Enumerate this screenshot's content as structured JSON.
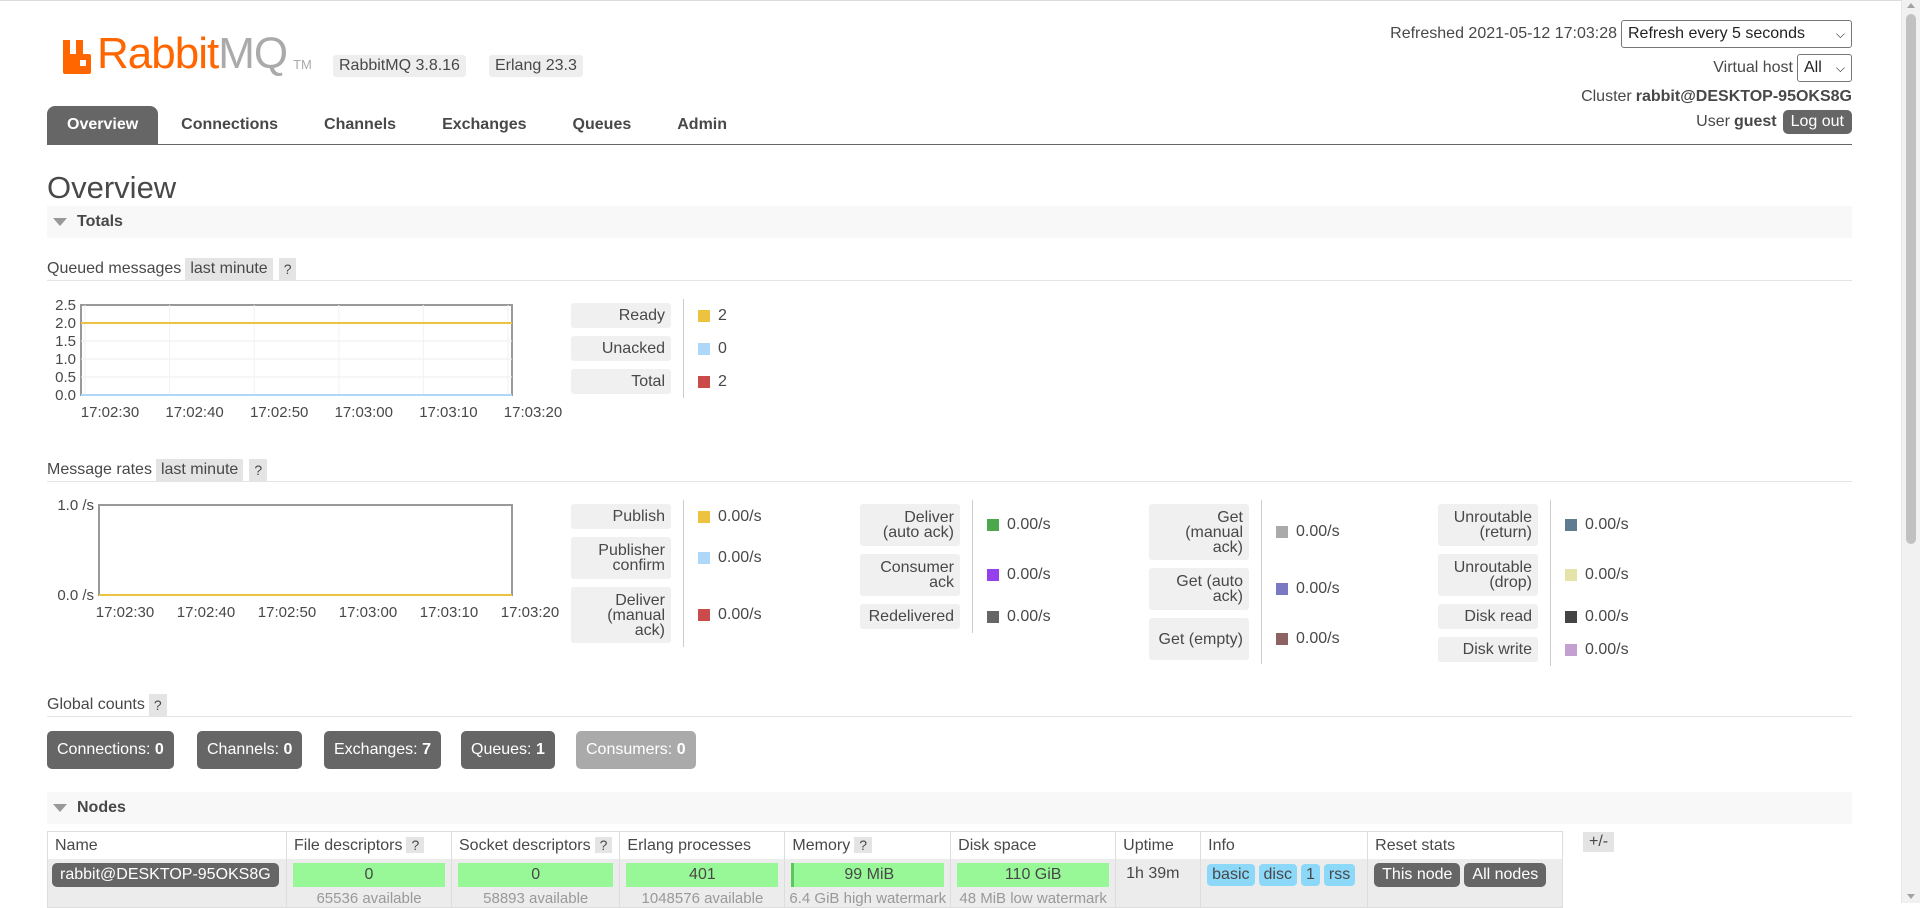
{
  "header": {
    "brand_primary": "Rabbit",
    "brand_secondary": "MQ",
    "brand_tm": "TM",
    "version_rabbitmq": "RabbitMQ 3.8.16",
    "version_erlang": "Erlang 23.3",
    "refreshed_label": "Refreshed 2021-05-12 17:03:28",
    "refresh_select": "Refresh every 5 seconds",
    "vhost_label": "Virtual host",
    "vhost_select": "All",
    "cluster_label": "Cluster",
    "cluster_value": "rabbit@DESKTOP-95OKS8G",
    "user_label": "User",
    "user_value": "guest",
    "logout_label": "Log out"
  },
  "tabs": [
    {
      "label": "Overview",
      "active": true
    },
    {
      "label": "Connections"
    },
    {
      "label": "Channels"
    },
    {
      "label": "Exchanges"
    },
    {
      "label": "Queues"
    },
    {
      "label": "Admin"
    }
  ],
  "page_title": "Overview",
  "totals": {
    "section_label": "Totals",
    "queued": {
      "label": "Queued messages",
      "range": "last minute",
      "help": "?",
      "legend": [
        {
          "label": "Ready",
          "value": "2",
          "color": "#edc240"
        },
        {
          "label": "Unacked",
          "value": "0",
          "color": "#afd8f8"
        },
        {
          "label": "Total",
          "value": "2",
          "color": "#cb4b4b"
        }
      ]
    },
    "rates": {
      "label": "Message rates",
      "range": "last minute",
      "help": "?",
      "columns": [
        [
          {
            "label": "Publish",
            "value": "0.00/s",
            "color": "#edc240"
          },
          {
            "label": "Publisher confirm",
            "value": "0.00/s",
            "color": "#afd8f8"
          },
          {
            "label": "Deliver (manual ack)",
            "value": "0.00/s",
            "color": "#cb4b4b"
          }
        ],
        [
          {
            "label": "Deliver (auto ack)",
            "value": "0.00/s",
            "color": "#4da74d"
          },
          {
            "label": "Consumer ack",
            "value": "0.00/s",
            "color": "#9440ed"
          },
          {
            "label": "Redelivered",
            "value": "0.00/s",
            "color": "#666666"
          }
        ],
        [
          {
            "label": "Get (manual ack)",
            "value": "0.00/s",
            "color": "#aaaaaa"
          },
          {
            "label": "Get (auto ack)",
            "value": "0.00/s",
            "color": "#7c79c3"
          },
          {
            "label": "Get (empty)",
            "value": "0.00/s",
            "color": "#8d6262"
          }
        ],
        [
          {
            "label": "Unroutable (return)",
            "value": "0.00/s",
            "color": "#5f7b8f"
          },
          {
            "label": "Unroutable (drop)",
            "value": "0.00/s",
            "color": "#e6e3a8"
          },
          {
            "label": "Disk read",
            "value": "0.00/s",
            "color": "#444444"
          },
          {
            "label": "Disk write",
            "value": "0.00/s",
            "color": "#c4a0d0"
          }
        ]
      ]
    }
  },
  "chart_data": [
    {
      "type": "line",
      "x": [
        "17:02:30",
        "17:02:40",
        "17:02:50",
        "17:03:00",
        "17:03:10",
        "17:03:20"
      ],
      "xlabel": "",
      "ylabel": "",
      "ylim": [
        0,
        2.5
      ],
      "yticks": [
        "0.0",
        "0.5",
        "1.0",
        "1.5",
        "2.0",
        "2.5"
      ],
      "grid": true,
      "series": [
        {
          "name": "Ready",
          "color": "#edc240",
          "values": [
            2,
            2,
            2,
            2,
            2,
            2
          ]
        },
        {
          "name": "Unacked",
          "color": "#afd8f8",
          "values": [
            0,
            0,
            0,
            0,
            0,
            0
          ]
        },
        {
          "name": "Total",
          "color": "#cb4b4b",
          "values": [
            2,
            2,
            2,
            2,
            2,
            2
          ]
        }
      ]
    },
    {
      "type": "line",
      "x": [
        "17:02:30",
        "17:02:40",
        "17:02:50",
        "17:03:00",
        "17:03:10",
        "17:03:20"
      ],
      "xlabel": "",
      "ylabel": "",
      "ylim": [
        0,
        1
      ],
      "yticks": [
        "0.0 /s",
        "1.0 /s"
      ],
      "grid": false,
      "series": [
        {
          "name": "Publish",
          "color": "#edc240",
          "values": [
            0,
            0,
            0,
            0,
            0,
            0
          ]
        },
        {
          "name": "Publisher confirm",
          "color": "#afd8f8",
          "values": [
            0,
            0,
            0,
            0,
            0,
            0
          ]
        },
        {
          "name": "Deliver (manual ack)",
          "color": "#cb4b4b",
          "values": [
            0,
            0,
            0,
            0,
            0,
            0
          ]
        },
        {
          "name": "Deliver (auto ack)",
          "color": "#4da74d",
          "values": [
            0,
            0,
            0,
            0,
            0,
            0
          ]
        },
        {
          "name": "Consumer ack",
          "color": "#9440ed",
          "values": [
            0,
            0,
            0,
            0,
            0,
            0
          ]
        },
        {
          "name": "Redelivered",
          "color": "#666666",
          "values": [
            0,
            0,
            0,
            0,
            0,
            0
          ]
        },
        {
          "name": "Get (manual ack)",
          "color": "#aaaaaa",
          "values": [
            0,
            0,
            0,
            0,
            0,
            0
          ]
        },
        {
          "name": "Get (auto ack)",
          "color": "#7c79c3",
          "values": [
            0,
            0,
            0,
            0,
            0,
            0
          ]
        },
        {
          "name": "Get (empty)",
          "color": "#8d6262",
          "values": [
            0,
            0,
            0,
            0,
            0,
            0
          ]
        },
        {
          "name": "Unroutable (return)",
          "color": "#5f7b8f",
          "values": [
            0,
            0,
            0,
            0,
            0,
            0
          ]
        },
        {
          "name": "Unroutable (drop)",
          "color": "#e6e3a8",
          "values": [
            0,
            0,
            0,
            0,
            0,
            0
          ]
        },
        {
          "name": "Disk read",
          "color": "#444444",
          "values": [
            0,
            0,
            0,
            0,
            0,
            0
          ]
        },
        {
          "name": "Disk write",
          "color": "#c4a0d0",
          "values": [
            0,
            0,
            0,
            0,
            0,
            0
          ]
        }
      ]
    }
  ],
  "global_counts": {
    "label": "Global counts",
    "help": "?",
    "items": [
      {
        "label": "Connections:",
        "value": "0"
      },
      {
        "label": "Channels:",
        "value": "0"
      },
      {
        "label": "Exchanges:",
        "value": "7"
      },
      {
        "label": "Queues:",
        "value": "1"
      },
      {
        "label": "Consumers:",
        "value": "0",
        "disabled": true
      }
    ]
  },
  "nodes": {
    "section_label": "Nodes",
    "plus_minus": "+/-",
    "columns": {
      "name": "Name",
      "file_descriptors": "File descriptors",
      "socket_descriptors": "Socket descriptors",
      "erlang_processes": "Erlang processes",
      "memory": "Memory",
      "disk_space": "Disk space",
      "uptime": "Uptime",
      "info": "Info",
      "reset_stats": "Reset stats"
    },
    "help": "?",
    "row": {
      "name": "rabbit@DESKTOP-95OKS8G",
      "file_descriptors": "0",
      "file_descriptors_sub": "65536 available",
      "socket_descriptors": "0",
      "socket_descriptors_sub": "58893 available",
      "erlang_processes": "401",
      "erlang_processes_sub": "1048576 available",
      "memory": "99 MiB",
      "memory_sub": "6.4 GiB high watermark",
      "disk_space": "110 GiB",
      "disk_space_sub": "48 MiB low watermark",
      "uptime": "1h 39m",
      "info_tags": [
        "basic",
        "disc",
        "1",
        "rss"
      ],
      "reset_this": "This node",
      "reset_all": "All nodes"
    }
  }
}
